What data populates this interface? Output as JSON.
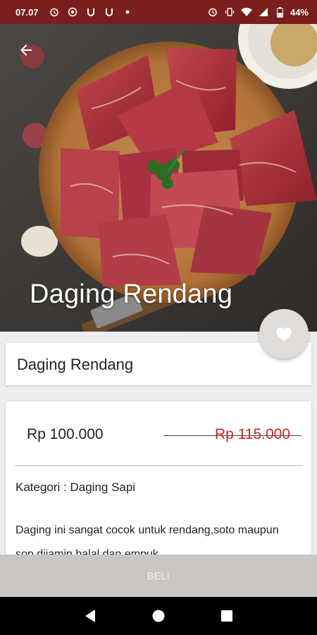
{
  "status_bar": {
    "time": "07.07",
    "battery": "44%",
    "icons": [
      "alarm-icon",
      "data-saver-icon",
      "u-icon",
      "u-icon",
      "dot-icon",
      "alarm-icon",
      "vibrate-icon",
      "wifi-icon",
      "signal-icon",
      "battery-icon"
    ]
  },
  "hero": {
    "title": "Daging Rendang",
    "back_icon": "arrow-back-icon"
  },
  "favorite": {
    "icon": "heart-icon"
  },
  "product": {
    "name": "Daging Rendang",
    "price": "Rp 100.000",
    "old_price": "Rp 115.000",
    "category": "Kategori : Daging Sapi",
    "description": "Daging ini sangat cocok untuk rendang,soto maupun sop dijamin halal dan empuk"
  },
  "buy_button": {
    "label": "BELI"
  },
  "nav_bar": {
    "icons": [
      "back-triangle-icon",
      "home-circle-icon",
      "recents-square-icon"
    ]
  },
  "colors": {
    "status_bar": "#7a1e1e",
    "old_price": "#c62828",
    "buy_bar": "#c9c6c4",
    "fab": "#e0dcd9"
  }
}
